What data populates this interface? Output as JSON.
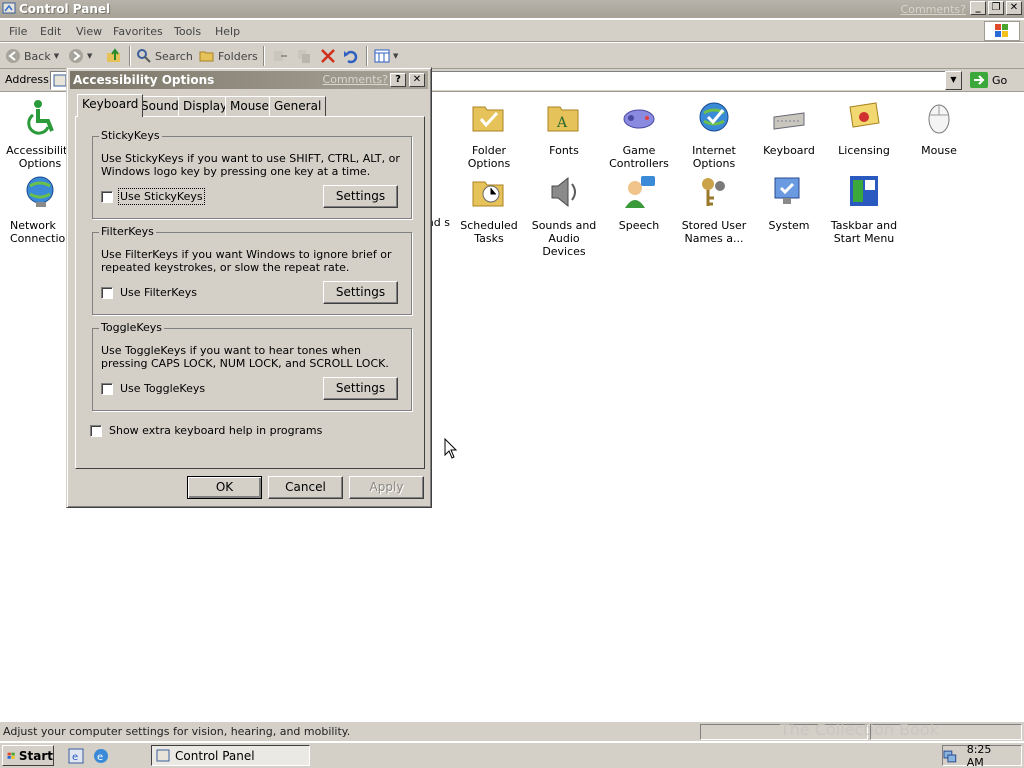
{
  "window": {
    "title": "Control Panel",
    "comments_link": "Comments?",
    "min": "_",
    "max": "❐",
    "close": "✕"
  },
  "menu": [
    "File",
    "Edit",
    "View",
    "Favorites",
    "Tools",
    "Help"
  ],
  "toolbar": {
    "back": "Back",
    "search": "Search",
    "folders": "Folders"
  },
  "address": {
    "label": "Address",
    "go": "Go"
  },
  "icons": [
    {
      "label": "Accessibility Options",
      "icon": "accessibility-icon"
    },
    {
      "label": "Folder Options",
      "icon": "folder-options-icon"
    },
    {
      "label": "Fonts",
      "icon": "fonts-icon"
    },
    {
      "label": "Game Controllers",
      "icon": "game-controller-icon"
    },
    {
      "label": "Internet Options",
      "icon": "internet-options-icon"
    },
    {
      "label": "Keyboard",
      "icon": "keyboard-icon"
    },
    {
      "label": "Licensing",
      "icon": "licensing-icon"
    },
    {
      "label": "Mouse",
      "icon": "mouse-icon"
    },
    {
      "label": "Network Connections",
      "icon": "network-icon"
    },
    {
      "label": "and s",
      "icon": "obscured-icon"
    },
    {
      "label": "Scheduled Tasks",
      "icon": "scheduled-tasks-icon"
    },
    {
      "label": "Sounds and Audio Devices",
      "icon": "sounds-icon"
    },
    {
      "label": "Speech",
      "icon": "speech-icon"
    },
    {
      "label": "Stored User Names a...",
      "icon": "stored-user-names-icon"
    },
    {
      "label": "System",
      "icon": "system-icon"
    },
    {
      "label": "Taskbar and Start Menu",
      "icon": "taskbar-icon"
    }
  ],
  "status": "Adjust your computer settings for vision, hearing, and mobility.",
  "taskbar": {
    "start": "Start",
    "task": "Control Panel",
    "clock": "8:25 AM",
    "watermark": "The Collection Book"
  },
  "dialog": {
    "title": "Accessibility Options",
    "comments": "Comments?",
    "help": "?",
    "close": "✕",
    "tabs": [
      "Keyboard",
      "Sound",
      "Display",
      "Mouse",
      "General"
    ],
    "groups": [
      {
        "title": "StickyKeys",
        "desc": "Use StickyKeys if you want to use SHIFT, CTRL, ALT, or Windows logo key by pressing one key at a time.",
        "check": "Use StickyKeys",
        "button": "Settings",
        "checked": false
      },
      {
        "title": "FilterKeys",
        "desc": "Use FilterKeys if you want Windows to ignore brief or repeated keystrokes, or slow the repeat rate.",
        "check": "Use FilterKeys",
        "button": "Settings",
        "checked": false
      },
      {
        "title": "ToggleKeys",
        "desc": "Use ToggleKeys if you want to hear tones when pressing CAPS LOCK, NUM LOCK, and SCROLL LOCK.",
        "check": "Use ToggleKeys",
        "button": "Settings",
        "checked": false
      }
    ],
    "extra_help": "Show extra keyboard help in programs",
    "ok": "OK",
    "cancel": "Cancel",
    "apply": "Apply"
  },
  "colors": {
    "titlebar_inactive": "#a7a296",
    "dialog_title": "#7b7668",
    "face": "#d4d0c8"
  }
}
